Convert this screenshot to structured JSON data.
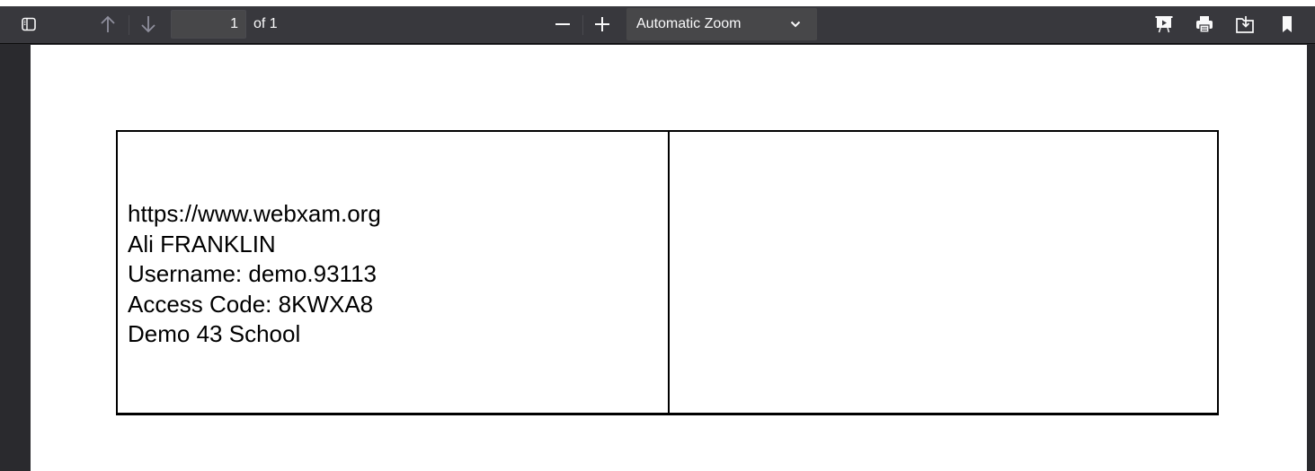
{
  "toolbar": {
    "page_number": "1",
    "page_count_label": "of 1",
    "zoom_label": "Automatic Zoom"
  },
  "card": {
    "lines": [
      "https://www.webxam.org",
      "Ali FRANKLIN",
      "Username: demo.93113",
      "Access Code: 8KWXA8",
      "Demo 43 School"
    ]
  },
  "icons": {
    "sidebar": "sidebar-toggle-icon",
    "previous": "arrow-up-icon",
    "next": "arrow-down-icon",
    "zoom_out": "minus-icon",
    "zoom_in": "plus-icon",
    "zoom_dropdown": "chevron-down-icon",
    "presentation": "presentation-mode-icon",
    "print": "print-icon",
    "download": "download-icon",
    "bookmark": "bookmark-icon"
  }
}
